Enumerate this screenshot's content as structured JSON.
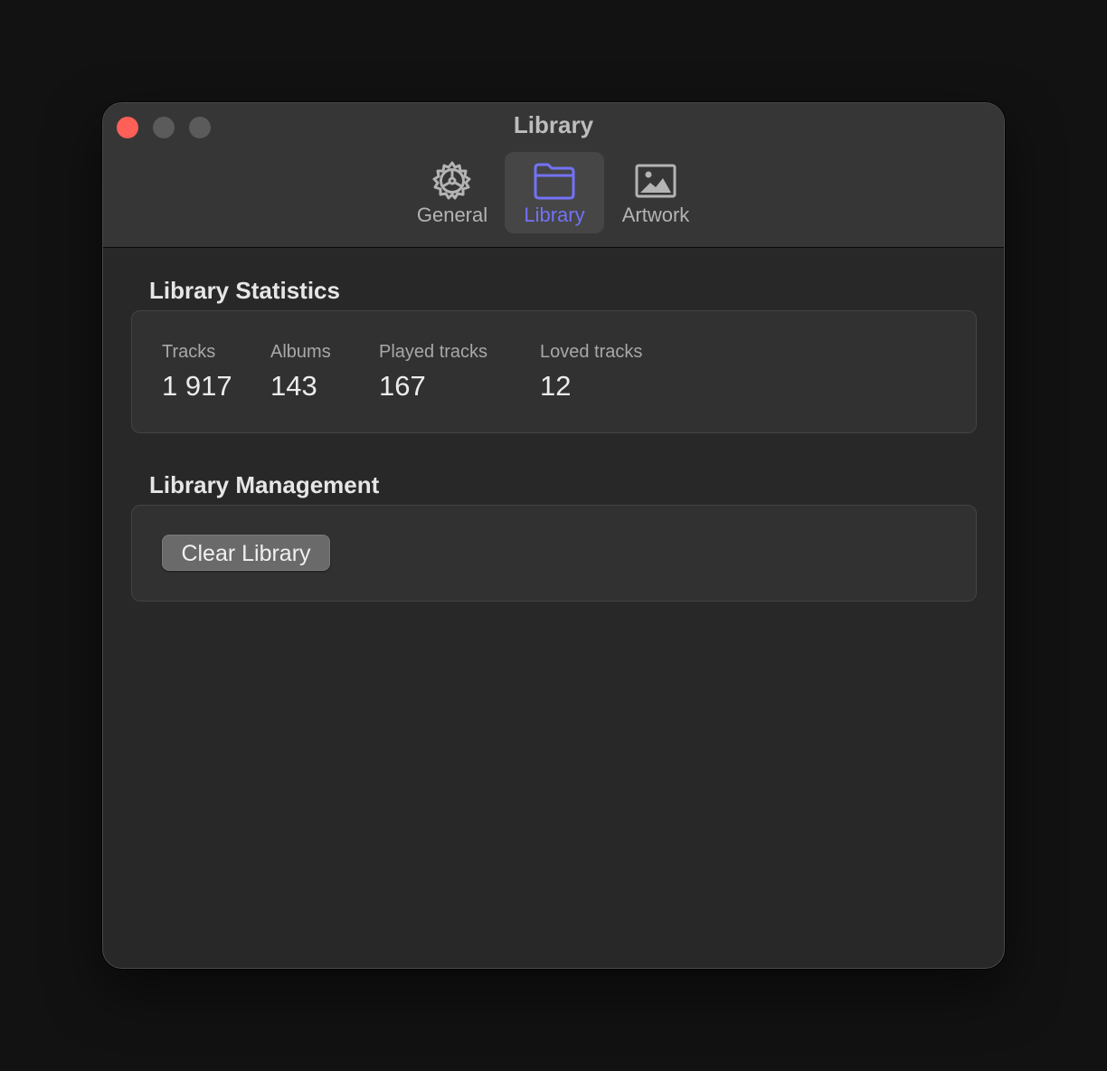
{
  "window": {
    "title": "Library"
  },
  "toolbar": {
    "tabs": [
      {
        "label": "General",
        "icon": "gear-icon",
        "active": false
      },
      {
        "label": "Library",
        "icon": "folder-icon",
        "active": true
      },
      {
        "label": "Artwork",
        "icon": "photo-icon",
        "active": false
      }
    ]
  },
  "statistics": {
    "heading": "Library Statistics",
    "items": [
      {
        "label": "Tracks",
        "value": "1 917"
      },
      {
        "label": "Albums",
        "value": "143"
      },
      {
        "label": "Played tracks",
        "value": "167"
      },
      {
        "label": "Loved tracks",
        "value": "12"
      }
    ]
  },
  "management": {
    "heading": "Library Management",
    "clear_button": "Clear Library"
  },
  "colors": {
    "accent": "#7372f7",
    "close": "#fe5f57",
    "window_bg": "#282828",
    "titlebar_bg": "#363636"
  }
}
